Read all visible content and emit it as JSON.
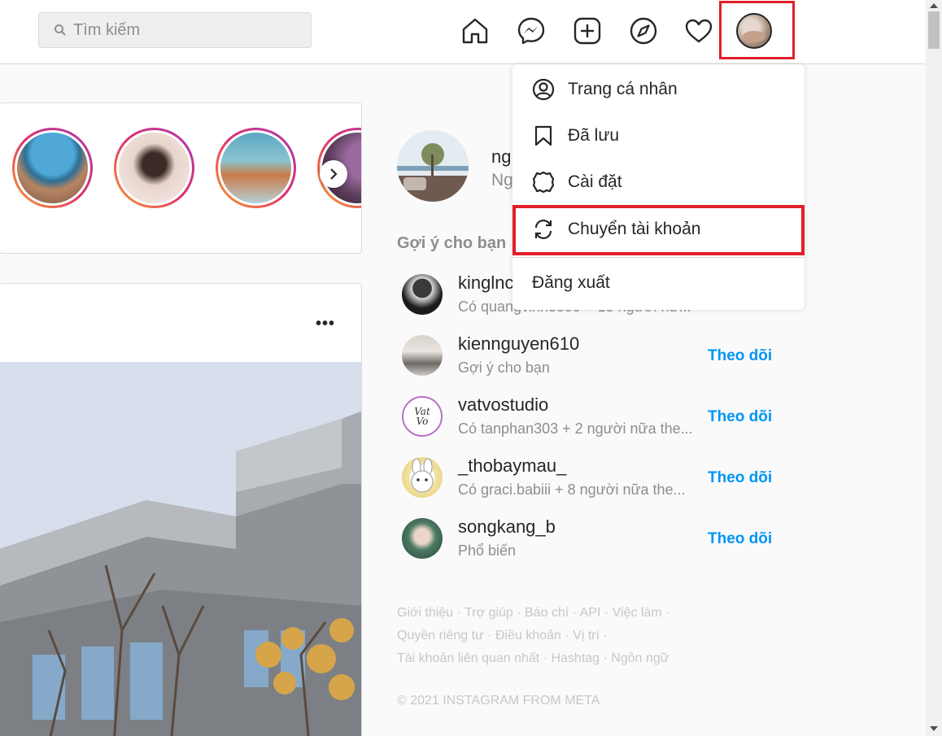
{
  "search": {
    "placeholder": "Tìm kiếm"
  },
  "nav": {
    "icons": [
      "home-icon",
      "messenger-icon",
      "new-post-icon",
      "explore-icon",
      "activity-heart-icon",
      "profile-avatar"
    ]
  },
  "profile": {
    "name_partial": "ng",
    "sub_partial": "Ng"
  },
  "suggestions": {
    "title": "Gợi ý cho bạn",
    "items": [
      {
        "username": "kinglnc",
        "subtitle": "Có quangvinh5599 + 15 người nữ...",
        "follow": ""
      },
      {
        "username": "kiennguyen610",
        "subtitle": "Gợi ý cho bạn",
        "follow": "Theo dõi"
      },
      {
        "username": "vatvostudio",
        "subtitle": "Có tanphan303 + 2 người nữa the...",
        "follow": "Theo dõi"
      },
      {
        "username": "_thobaymau_",
        "subtitle": "Có graci.babiii + 8 người nữa the...",
        "follow": "Theo dõi"
      },
      {
        "username": "songkang_b",
        "subtitle": "Phổ biến",
        "follow": "Theo dõi"
      }
    ]
  },
  "footer": {
    "line1": "Giới thiệu · Trợ giúp · Báo chí · API · Việc làm ·",
    "line2": "Quyền riêng tư · Điều khoản · Vị trí ·",
    "line3": "Tài khoản liên quan nhất · Hashtag · Ngôn ngữ",
    "copyright": "© 2021 INSTAGRAM FROM META"
  },
  "dropdown": {
    "items": [
      {
        "label": "Trang cá nhân",
        "icon": "profile-circle-icon"
      },
      {
        "label": "Đã lưu",
        "icon": "bookmark-icon"
      },
      {
        "label": "Cài đặt",
        "icon": "settings-gear-icon"
      },
      {
        "label": "Chuyển tài khoản",
        "icon": "switch-account-icon"
      },
      {
        "label": "Đăng xuất",
        "icon": ""
      }
    ]
  },
  "post": {
    "more_label": "•••"
  },
  "colors": {
    "highlight": "#e0202a",
    "follow": "#0095f6",
    "secondary_text": "#8e8e8e",
    "border": "#dbdbdb"
  }
}
